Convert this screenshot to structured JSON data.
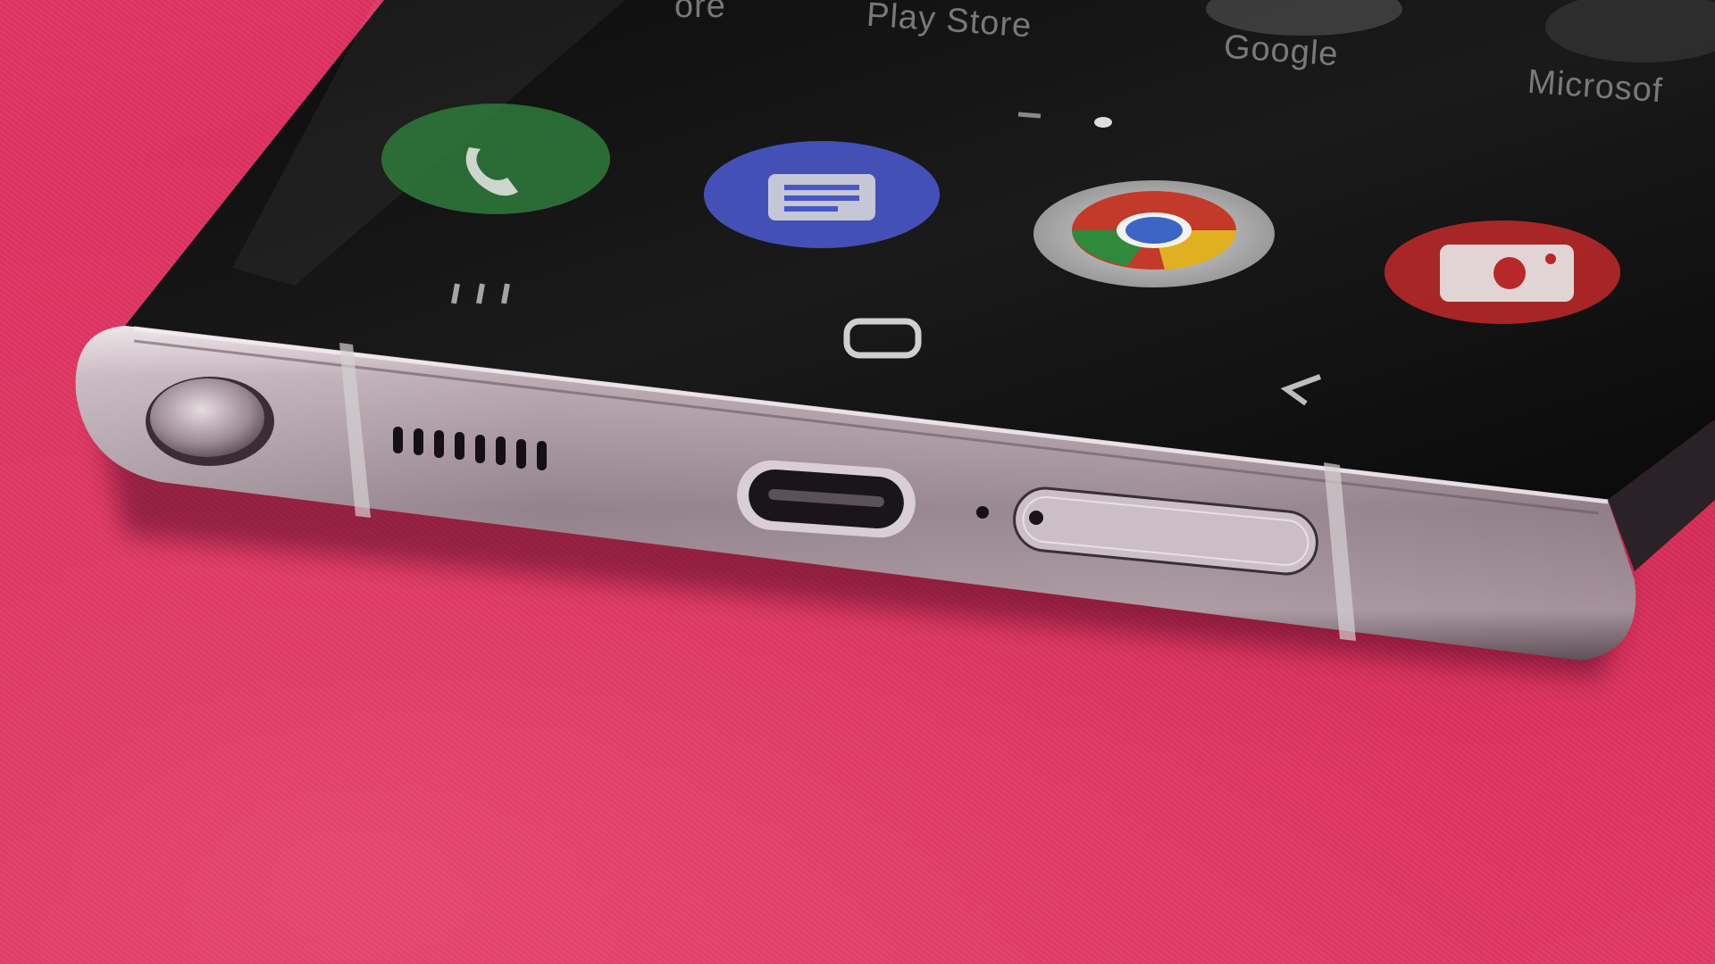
{
  "scene": {
    "description_free": true
  },
  "home_screen": {
    "app_labels": {
      "partial_left": "ore",
      "play_store": "Play Store",
      "google": "Google",
      "microsoft": "Microsof"
    },
    "dock_icons": [
      "phone-icon",
      "messages-icon",
      "chrome-icon",
      "camera-icon"
    ],
    "nav_buttons": [
      "recents-icon",
      "home-icon",
      "back-icon"
    ]
  },
  "hardware": {
    "features": [
      "s-pen-slot",
      "speaker-grille",
      "usb-c-port",
      "microphone-hole",
      "sim-tray",
      "antenna-band"
    ]
  },
  "colors": {
    "background": "#e0305f",
    "frame": "#b8a8b0",
    "screen": "#141414"
  }
}
